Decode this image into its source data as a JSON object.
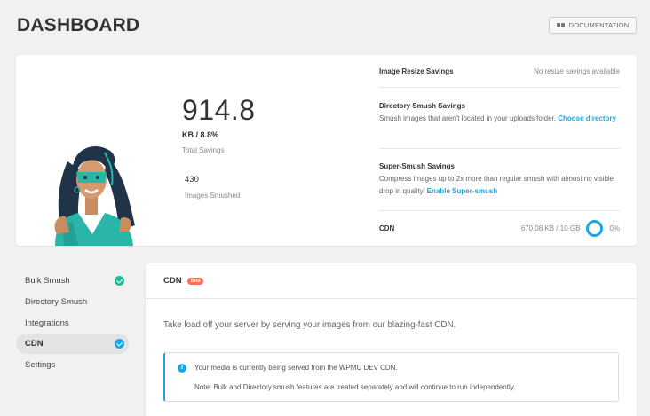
{
  "header": {
    "title": "DASHBOARD",
    "doc_button_label": "DOCUMENTATION",
    "doc_icon": "book-icon"
  },
  "summary": {
    "total_savings_value": "914.8",
    "total_savings_unit": "KB / 8.8%",
    "total_savings_label": "Total Savings",
    "images_count": "430",
    "images_label": "Images Smushed",
    "rows": {
      "resize": {
        "title": "Image Resize Savings",
        "value": "No resize savings available"
      },
      "directory": {
        "title": "Directory Smush Savings",
        "desc": "Smush images that aren't located in your uploads folder. ",
        "link": "Choose directory"
      },
      "super": {
        "title": "Super-Smush Savings",
        "desc": "Compress images up to 2x more than regular smush with almost no visible drop in quality. ",
        "link": "Enable Super-smush"
      },
      "cdn": {
        "title": "CDN",
        "usage": "670.08 KB / 10 GB",
        "percent": "0%",
        "usage_fraction": 0
      }
    }
  },
  "sidebar": {
    "items": [
      {
        "label": "Bulk Smush",
        "checked": true,
        "check_color": "#1abc9c"
      },
      {
        "label": "Directory Smush",
        "checked": false
      },
      {
        "label": "Integrations",
        "checked": false
      },
      {
        "label": "CDN",
        "checked": true,
        "active": true,
        "check_color": "#17a8e3"
      },
      {
        "label": "Settings",
        "checked": false
      }
    ]
  },
  "panel": {
    "title": "CDN",
    "badge": "Beta",
    "description": "Take load off your server by serving your images from our blazing-fast CDN.",
    "notice_line1": "Your media is currently being served from the WPMU DEV CDN.",
    "notice_line2": "Note: Bulk and Directory smush features are treated separately and will continue to run independently."
  },
  "colors": {
    "accent": "#17a8e3",
    "success": "#1abc9c",
    "beta": "#fd6e4f"
  }
}
